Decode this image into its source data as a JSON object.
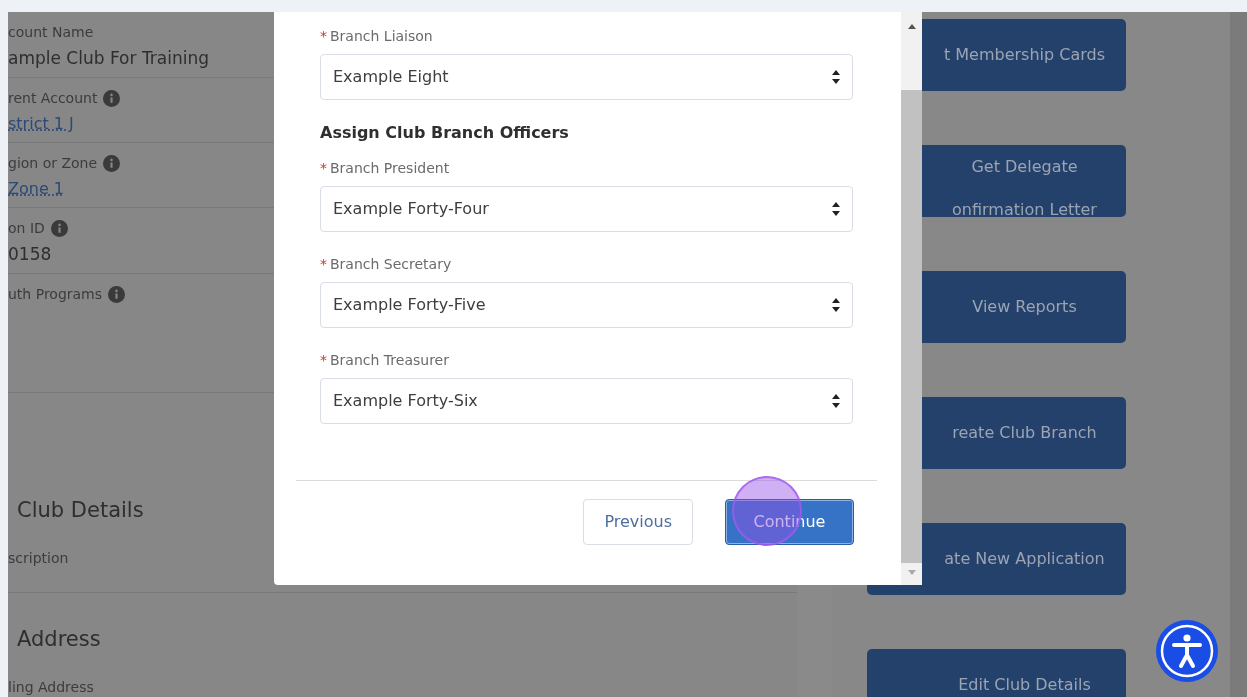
{
  "record": {
    "fields": [
      {
        "label": "count Name",
        "value": "ample Club For Training",
        "link": false,
        "info": false
      },
      {
        "label": "rent Account",
        "value": "strict 1 J",
        "link": true,
        "info": true
      },
      {
        "label": "gion or Zone",
        "value": "Zone 1",
        "link": true,
        "info": true
      },
      {
        "label": "on ID",
        "value": "0158",
        "link": false,
        "info": true
      },
      {
        "label": "uth Programs",
        "info": true
      }
    ],
    "sections": [
      {
        "title": "Club Details",
        "fields": [
          {
            "label": "scription"
          }
        ]
      },
      {
        "title": "Address",
        "fields": [
          {
            "label": "ling Address"
          }
        ]
      }
    ]
  },
  "actions": [
    {
      "lines": [
        "t Membership Cards"
      ]
    },
    {
      "lines": [
        "Get Delegate",
        "onfirmation Letter"
      ]
    },
    {
      "lines": [
        "View Reports"
      ]
    },
    {
      "lines": [
        "reate Club Branch"
      ]
    },
    {
      "lines": [
        "ate New Application"
      ]
    },
    {
      "lines": [
        "Edit Club Details"
      ]
    }
  ],
  "modal": {
    "items": [
      {
        "kind": "select",
        "marker": "*",
        "label": "Branch Liaison",
        "value": "Example Eight"
      },
      {
        "kind": "heading",
        "text": "Assign Club Branch Officers"
      },
      {
        "kind": "select",
        "marker": "*",
        "label": "Branch President",
        "value": "Example Forty-Four"
      },
      {
        "kind": "select",
        "marker": "*",
        "label": "Branch Secretary",
        "value": "Example Forty-Five"
      },
      {
        "kind": "select",
        "marker": "*",
        "label": "Branch Treasurer",
        "value": "Example Forty-Six"
      }
    ],
    "buttons": [
      {
        "label": "Previous",
        "kind": "neutral"
      },
      {
        "label": "Continue",
        "kind": "brand"
      }
    ]
  }
}
